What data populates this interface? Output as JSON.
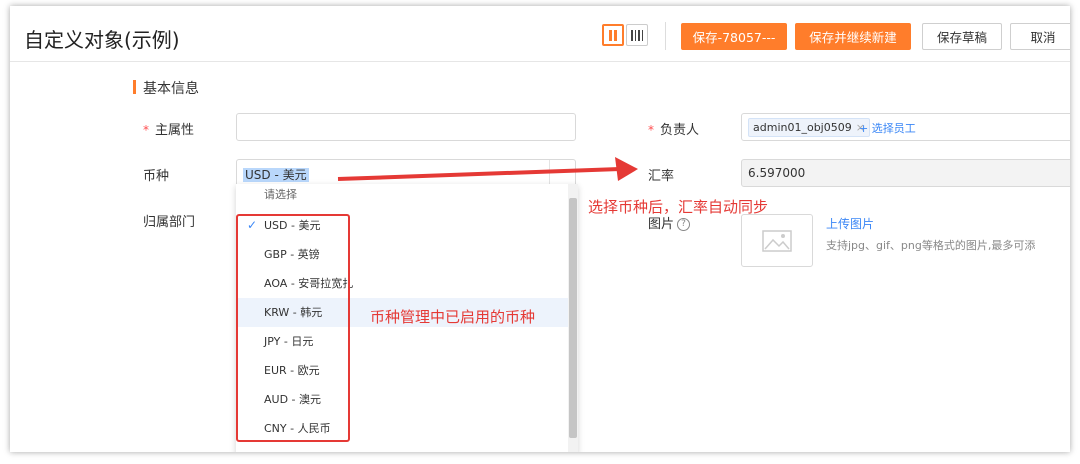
{
  "header": {
    "title": "自定义对象(示例)",
    "buttons": {
      "save": "保存-78057---",
      "save_new": "保存并继续新建",
      "save_draft": "保存草稿",
      "cancel": "取消"
    }
  },
  "section": {
    "title": "基本信息"
  },
  "fields": {
    "main_attr": {
      "label": "主属性",
      "required": true,
      "value": ""
    },
    "owner": {
      "label": "负责人",
      "required": true,
      "tag": "admin01_obj0509",
      "tag_close": "×",
      "add_label": "+ 选择员工"
    },
    "currency": {
      "label": "币种",
      "value": "USD - 美元"
    },
    "rate": {
      "label": "汇率",
      "value": "6.597000"
    },
    "dept": {
      "label": "归属部门"
    },
    "image": {
      "label": "图片",
      "help": "?",
      "upload_label": "上传图片",
      "hint": "支持jpg、gif、png等格式的图片,最多可添"
    }
  },
  "dropdown": {
    "placeholder": "请选择",
    "check": "✓",
    "options": [
      {
        "label": "USD - 美元",
        "selected": true
      },
      {
        "label": "GBP - 英镑",
        "selected": false
      },
      {
        "label": "AOA - 安哥拉宽扎",
        "selected": false
      },
      {
        "label": "KRW - 韩元",
        "selected": false,
        "hover": true
      },
      {
        "label": "JPY - 日元",
        "selected": false
      },
      {
        "label": "EUR - 欧元",
        "selected": false
      },
      {
        "label": "AUD - 澳元",
        "selected": false
      },
      {
        "label": "CNY - 人民币",
        "selected": false
      }
    ]
  },
  "annotations": {
    "sync_note": "选择币种后，汇率自动同步",
    "enabled_note": "币种管理中已启用的币种"
  },
  "colors": {
    "accent": "#ff7d2b",
    "link": "#3b87f6",
    "annotation": "#e53935",
    "required": "#ff4d4f"
  }
}
